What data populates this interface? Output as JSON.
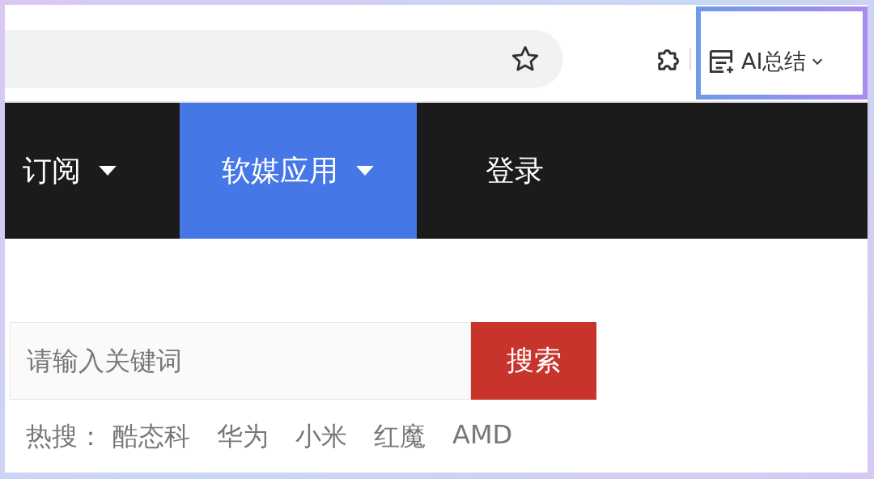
{
  "toolbar": {
    "ai_button": {
      "label": "AI总结",
      "highlighted": true
    }
  },
  "nav": {
    "items": [
      {
        "label": "订阅",
        "dropdown": true,
        "selected": false
      },
      {
        "label": "软媒应用",
        "dropdown": true,
        "selected": true
      },
      {
        "label": "登录",
        "dropdown": false,
        "selected": false
      }
    ]
  },
  "search": {
    "placeholder": "请输入关键词",
    "button": "搜索"
  },
  "hot_search": {
    "label": "热搜：",
    "terms": [
      "酷态科",
      "华为",
      "小米",
      "红魔",
      "AMD"
    ]
  }
}
